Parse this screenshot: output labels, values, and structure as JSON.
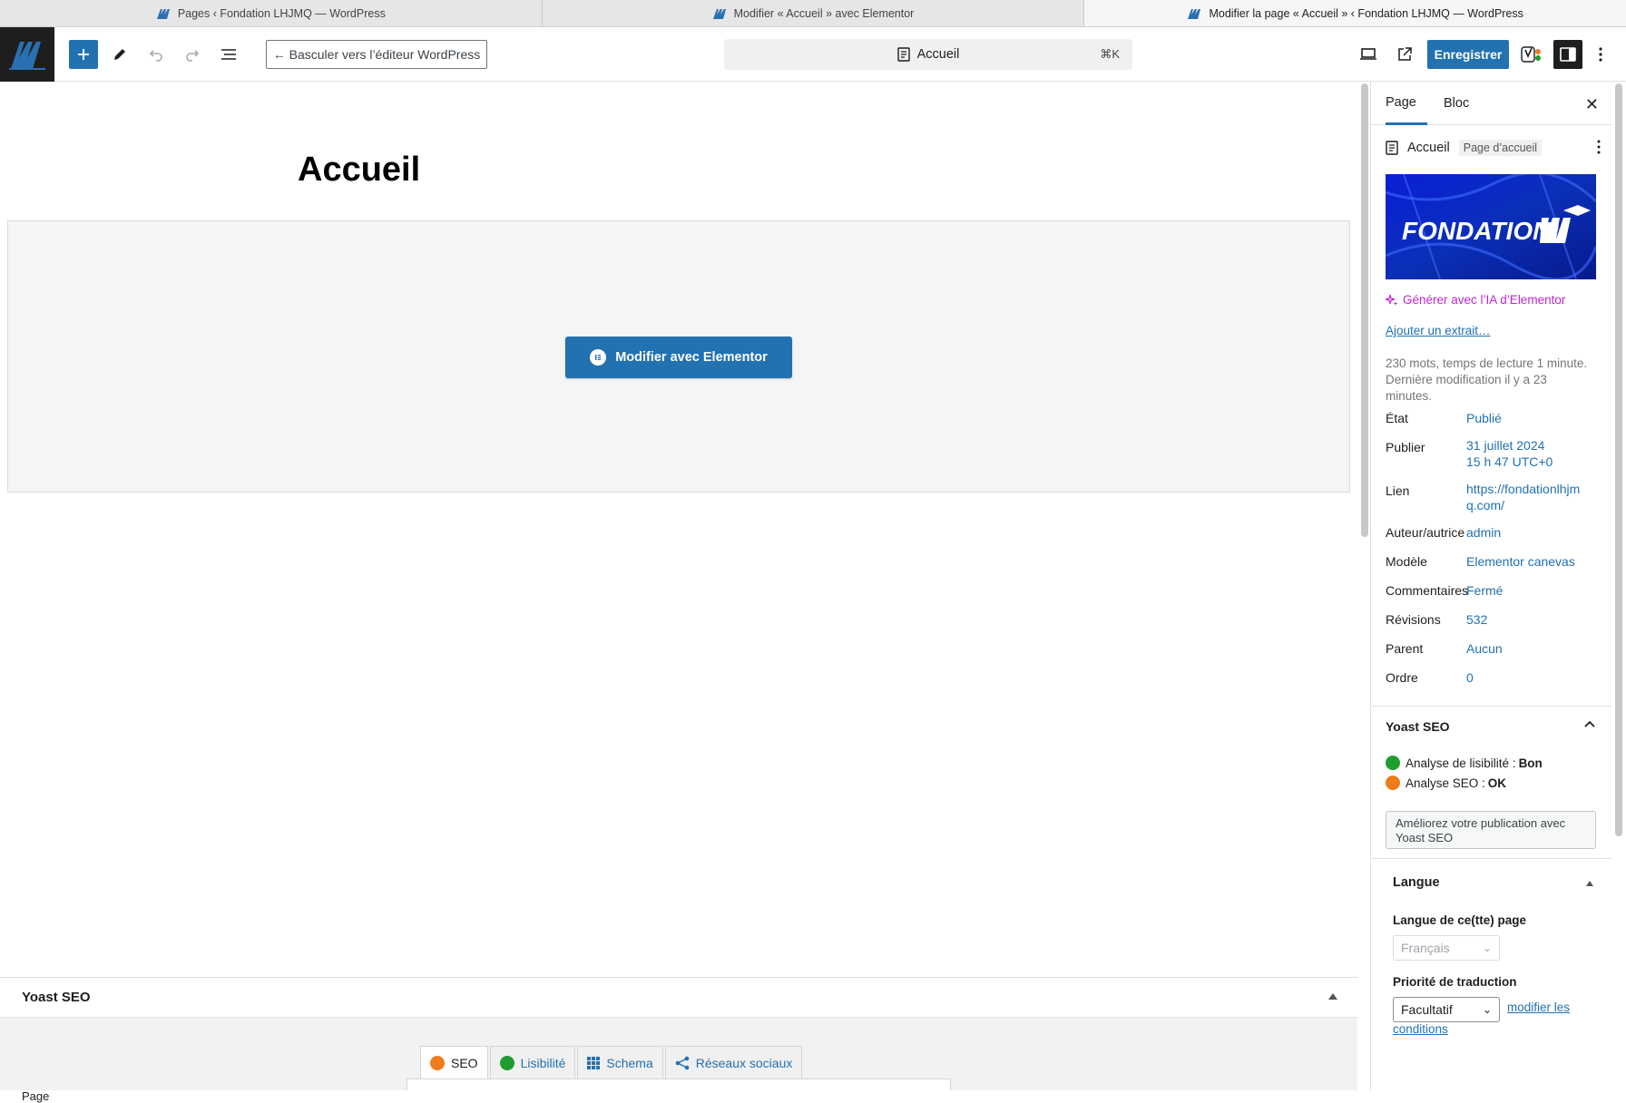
{
  "browser_tabs": [
    {
      "title": "Pages ‹ Fondation LHJMQ — WordPress"
    },
    {
      "title": "Modifier « Accueil » avec Elementor"
    },
    {
      "title": "Modifier la page « Accueil » ‹ Fondation LHJMQ — WordPress"
    }
  ],
  "header": {
    "switch_label": "← Basculer vers l’éditeur WordPress",
    "doc_title": "Accueil",
    "shortcut": "⌘K",
    "save_label": "Enregistrer"
  },
  "canvas": {
    "page_title": "Accueil",
    "elementor_button": "Modifier avec Elementor"
  },
  "yoast_panel": {
    "title": "Yoast SEO",
    "tabs": [
      "SEO",
      "Lisibilité",
      "Schema",
      "Réseaux sociaux"
    ]
  },
  "sidebar": {
    "tab_page": "Page",
    "tab_block": "Bloc",
    "page_name": "Accueil",
    "page_badge": "Page d’accueil",
    "featured_logo": "FONDATION LHJMQ",
    "ai_link": "Générer avec l’IA d’Elementor",
    "excerpt_link": "Ajouter un extrait…",
    "stats_line1": "230 mots, temps de lecture 1 minute.",
    "stats_line2": "Dernière modification il y a 23 minutes.",
    "props": [
      {
        "label": "État",
        "value": "Publié"
      },
      {
        "label": "Publier",
        "value": "31 juillet 2024",
        "value2": "15 h 47 UTC+0"
      },
      {
        "label": "Lien",
        "value": "https://fondationlhjm",
        "value2": "q.com/"
      },
      {
        "label": "Auteur/autrice",
        "value": "admin"
      },
      {
        "label": "Modèle",
        "value": "Elementor canevas"
      },
      {
        "label": "Commentaires",
        "value": "Fermé"
      },
      {
        "label": "Révisions",
        "value": "532"
      },
      {
        "label": "Parent",
        "value": "Aucun"
      },
      {
        "label": "Ordre",
        "value": "0"
      }
    ],
    "yoast": {
      "title": "Yoast SEO",
      "readability_label": "Analyse de lisibilité : ",
      "readability_value": "Bon",
      "seo_label": "Analyse SEO : ",
      "seo_value": "OK",
      "improve_button": "Améliorez votre publication avec Yoast SEO"
    },
    "langue": {
      "title": "Langue",
      "lang_label": "Langue de ce(tte) page",
      "lang_value": "Français",
      "priority_label": "Priorité de traduction",
      "priority_value": "Facultatif",
      "conditions_link_1": "modifier les",
      "conditions_link_2": "conditions"
    }
  },
  "status": {
    "text": "Page"
  },
  "colors": {
    "accent": "#2271b1",
    "ai": "#c026d3",
    "good": "#1f9d2e",
    "ok": "#ee7c1b"
  }
}
